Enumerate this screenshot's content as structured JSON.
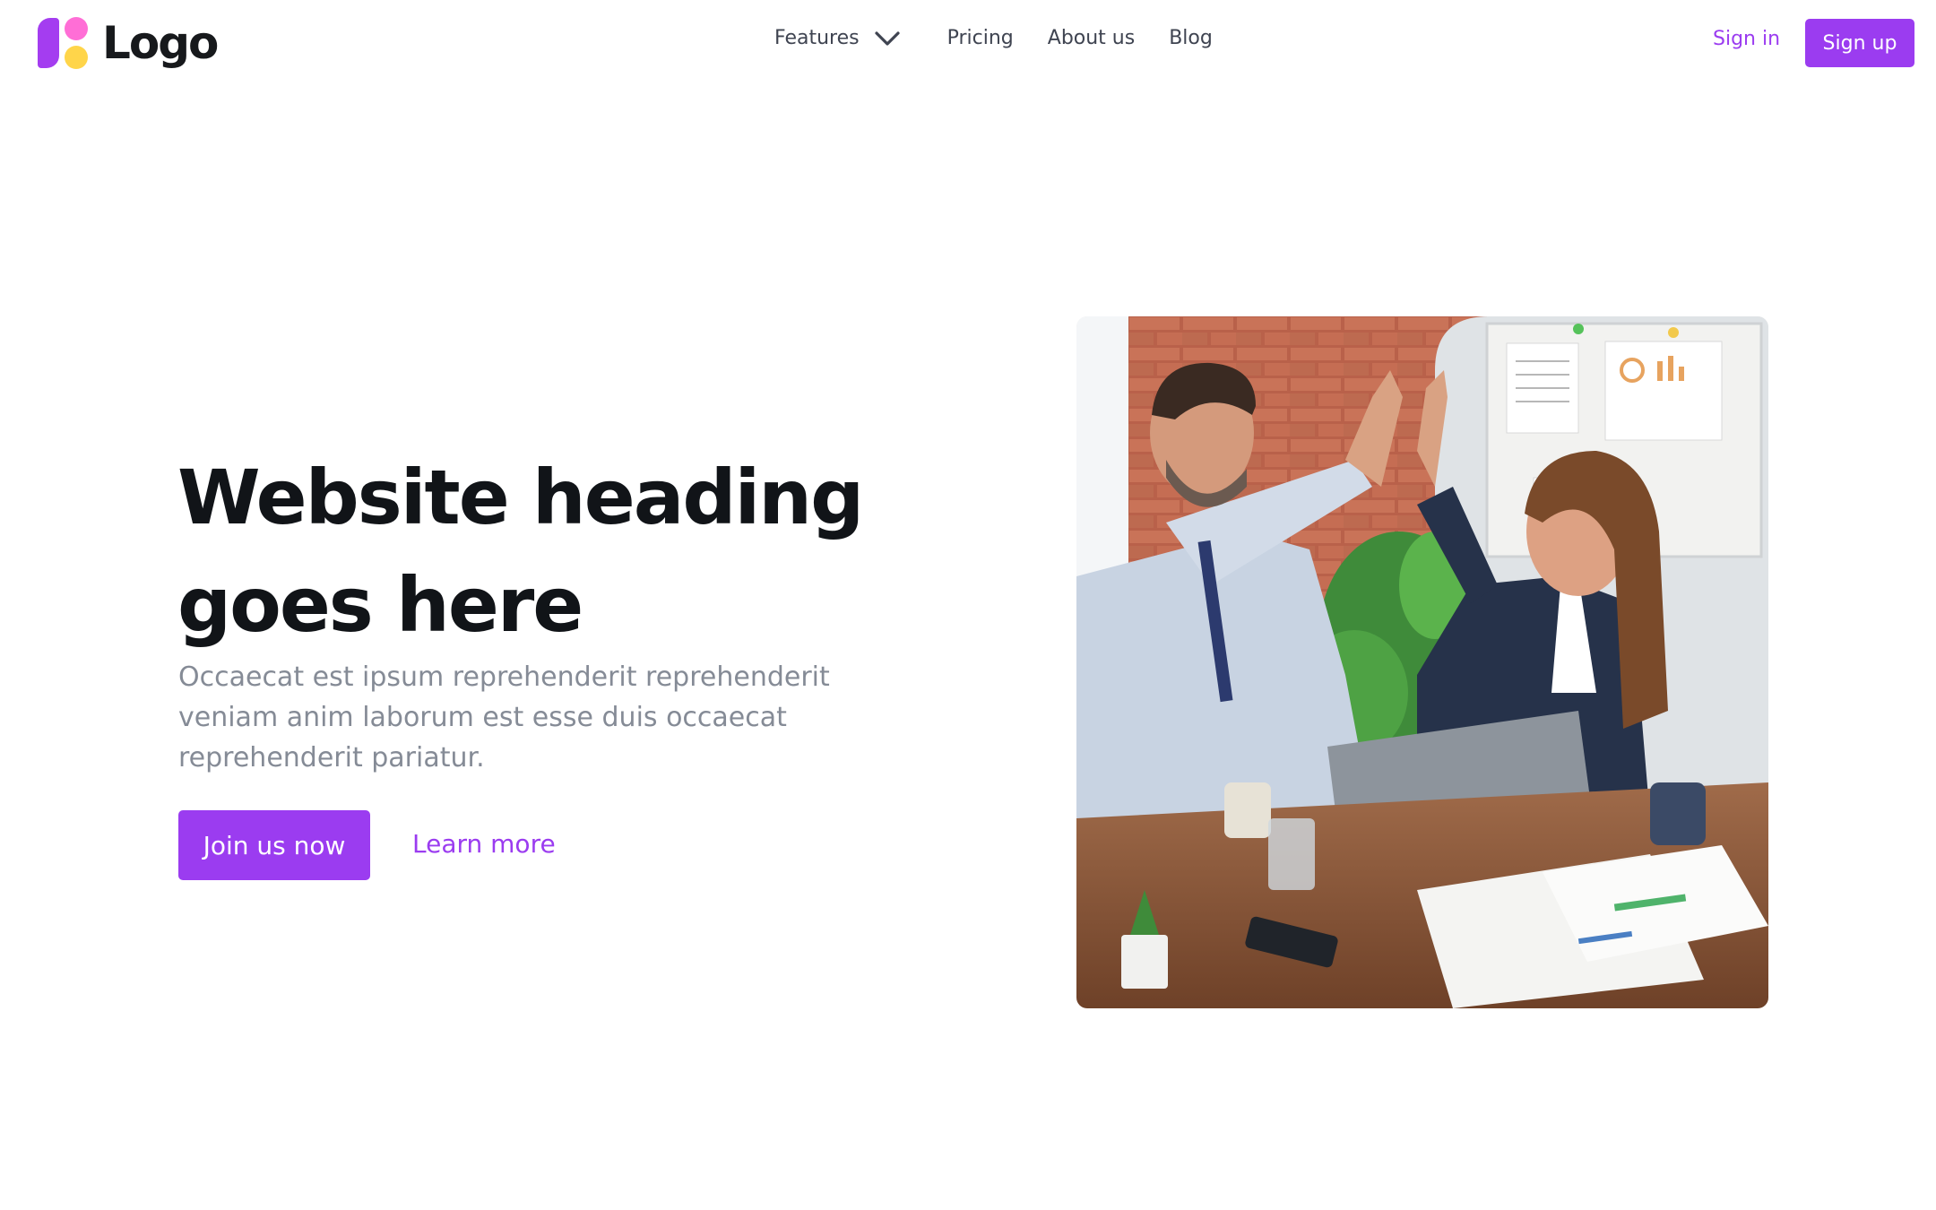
{
  "brand": {
    "name": "Logo",
    "colors": {
      "primary": "#9b3cf0",
      "pink": "#ff6ed6",
      "yellow": "#ffd54a"
    }
  },
  "nav": {
    "items": [
      {
        "label": "Features",
        "icon": "chevron-down-icon"
      },
      {
        "label": "Pricing"
      },
      {
        "label": "About us"
      },
      {
        "label": "Blog"
      }
    ]
  },
  "auth": {
    "sign_in": "Sign in",
    "sign_up": "Sign up"
  },
  "hero": {
    "title": "Website heading goes here",
    "subtitle": "Occaecat est ipsum reprehenderit reprehenderit veniam anim laborum est esse duis occaecat reprehenderit pariatur.",
    "primary_cta": "Join us now",
    "secondary_cta": "Learn more",
    "image": "office-high-five-photo"
  }
}
